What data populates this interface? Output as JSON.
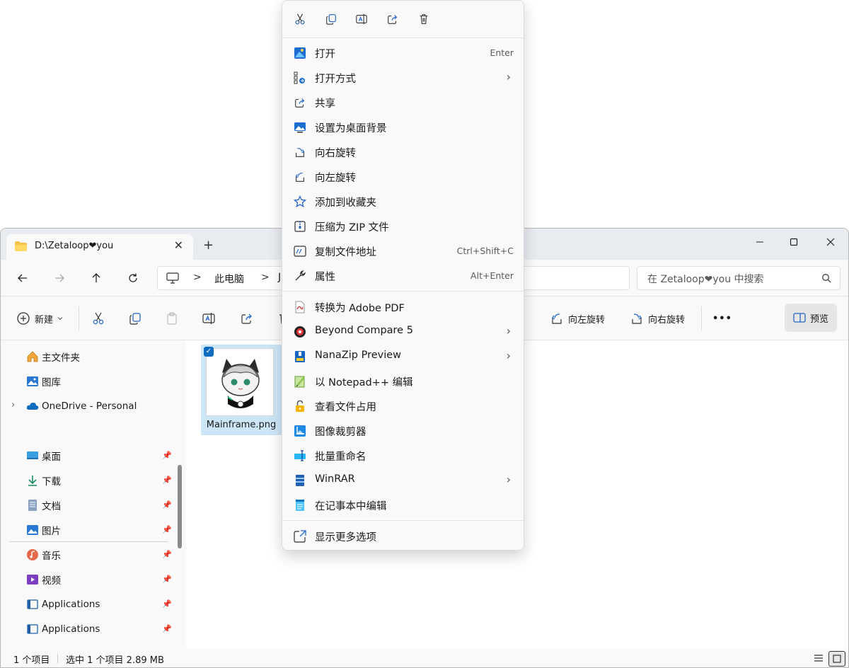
{
  "window": {
    "tab_title": "D:\\Zetaloop❤you",
    "tab_close": "✕",
    "new_tab": "+"
  },
  "address": {
    "crumb": "此电脑",
    "crumb2": "J",
    "separator": ">"
  },
  "search": {
    "placeholder": "在 Zetaloop❤you 中搜索"
  },
  "commandbar": {
    "new_label": "新建",
    "rotate_left": "向左旋转",
    "rotate_right": "向右旋转",
    "more": "•••",
    "preview": "预览"
  },
  "sidebar": {
    "top_items": [
      {
        "label": "主文件夹",
        "icon": "home-icon"
      },
      {
        "label": "图库",
        "icon": "gallery-icon"
      },
      {
        "label": "OneDrive - Personal",
        "icon": "cloud-icon"
      }
    ],
    "pinned_items": [
      {
        "label": "桌面",
        "icon": "desktop-icon"
      },
      {
        "label": "下载",
        "icon": "download-icon"
      },
      {
        "label": "文档",
        "icon": "document-icon"
      },
      {
        "label": "图片",
        "icon": "pictures-icon"
      },
      {
        "label": "音乐",
        "icon": "music-icon"
      },
      {
        "label": "视频",
        "icon": "video-icon"
      },
      {
        "label": "Applications",
        "icon": "app-icon"
      },
      {
        "label": "Applications",
        "icon": "app-icon"
      }
    ]
  },
  "file": {
    "name": "Mainframe.png",
    "selected": true
  },
  "status": {
    "count": "1 个项目",
    "selected": "选中 1 个项目  2.89 MB"
  },
  "menu": {
    "quick_actions": [
      "cut-icon",
      "copy-icon",
      "rename-icon",
      "share-icon",
      "delete-icon"
    ],
    "group1": [
      {
        "label": "打开",
        "accel": "Enter",
        "icon": "photos-icon",
        "submenu": false
      },
      {
        "label": "打开方式",
        "accel": "",
        "icon": "open-with-icon",
        "submenu": true
      },
      {
        "label": "共享",
        "accel": "",
        "icon": "share-icon",
        "submenu": false
      },
      {
        "label": "设置为桌面背景",
        "accel": "",
        "icon": "wallpaper-icon",
        "submenu": false
      },
      {
        "label": "向右旋转",
        "accel": "",
        "icon": "rotate-right-icon",
        "submenu": false
      },
      {
        "label": "向左旋转",
        "accel": "",
        "icon": "rotate-left-icon",
        "submenu": false
      },
      {
        "label": "添加到收藏夹",
        "accel": "",
        "icon": "star-icon",
        "submenu": false
      },
      {
        "label": "压缩为 ZIP 文件",
        "accel": "",
        "icon": "zip-icon",
        "submenu": false
      },
      {
        "label": "复制文件地址",
        "accel": "Ctrl+Shift+C",
        "icon": "copy-path-icon",
        "submenu": false
      },
      {
        "label": "属性",
        "accel": "Alt+Enter",
        "icon": "wrench-icon",
        "submenu": false
      }
    ],
    "group2": [
      {
        "label": "转换为 Adobe PDF",
        "accel": "",
        "icon": "pdf-icon",
        "submenu": false
      },
      {
        "label": "Beyond Compare 5",
        "accel": "",
        "icon": "beyond-compare-icon",
        "submenu": true
      },
      {
        "label": "NanaZip Preview",
        "accel": "",
        "icon": "nanazip-icon",
        "submenu": true
      },
      {
        "label": "以 Notepad++ 编辑",
        "accel": "",
        "icon": "notepadpp-icon",
        "submenu": false
      },
      {
        "label": "查看文件占用",
        "accel": "",
        "icon": "lock-icon",
        "submenu": false
      },
      {
        "label": "图像裁剪器",
        "accel": "",
        "icon": "crop-icon",
        "submenu": false
      },
      {
        "label": "批量重命名",
        "accel": "",
        "icon": "rename-batch-icon",
        "submenu": false
      },
      {
        "label": "WinRAR",
        "accel": "",
        "icon": "winrar-icon",
        "submenu": true
      },
      {
        "label": "在记事本中编辑",
        "accel": "",
        "icon": "notepad-icon",
        "submenu": false
      }
    ],
    "more_options": {
      "label": "显示更多选项",
      "icon": "more-options-icon"
    }
  },
  "colors": {
    "accent": "#0f6cbd",
    "selection": "#cde6f7",
    "menu_bg": "#f9f9f9"
  }
}
